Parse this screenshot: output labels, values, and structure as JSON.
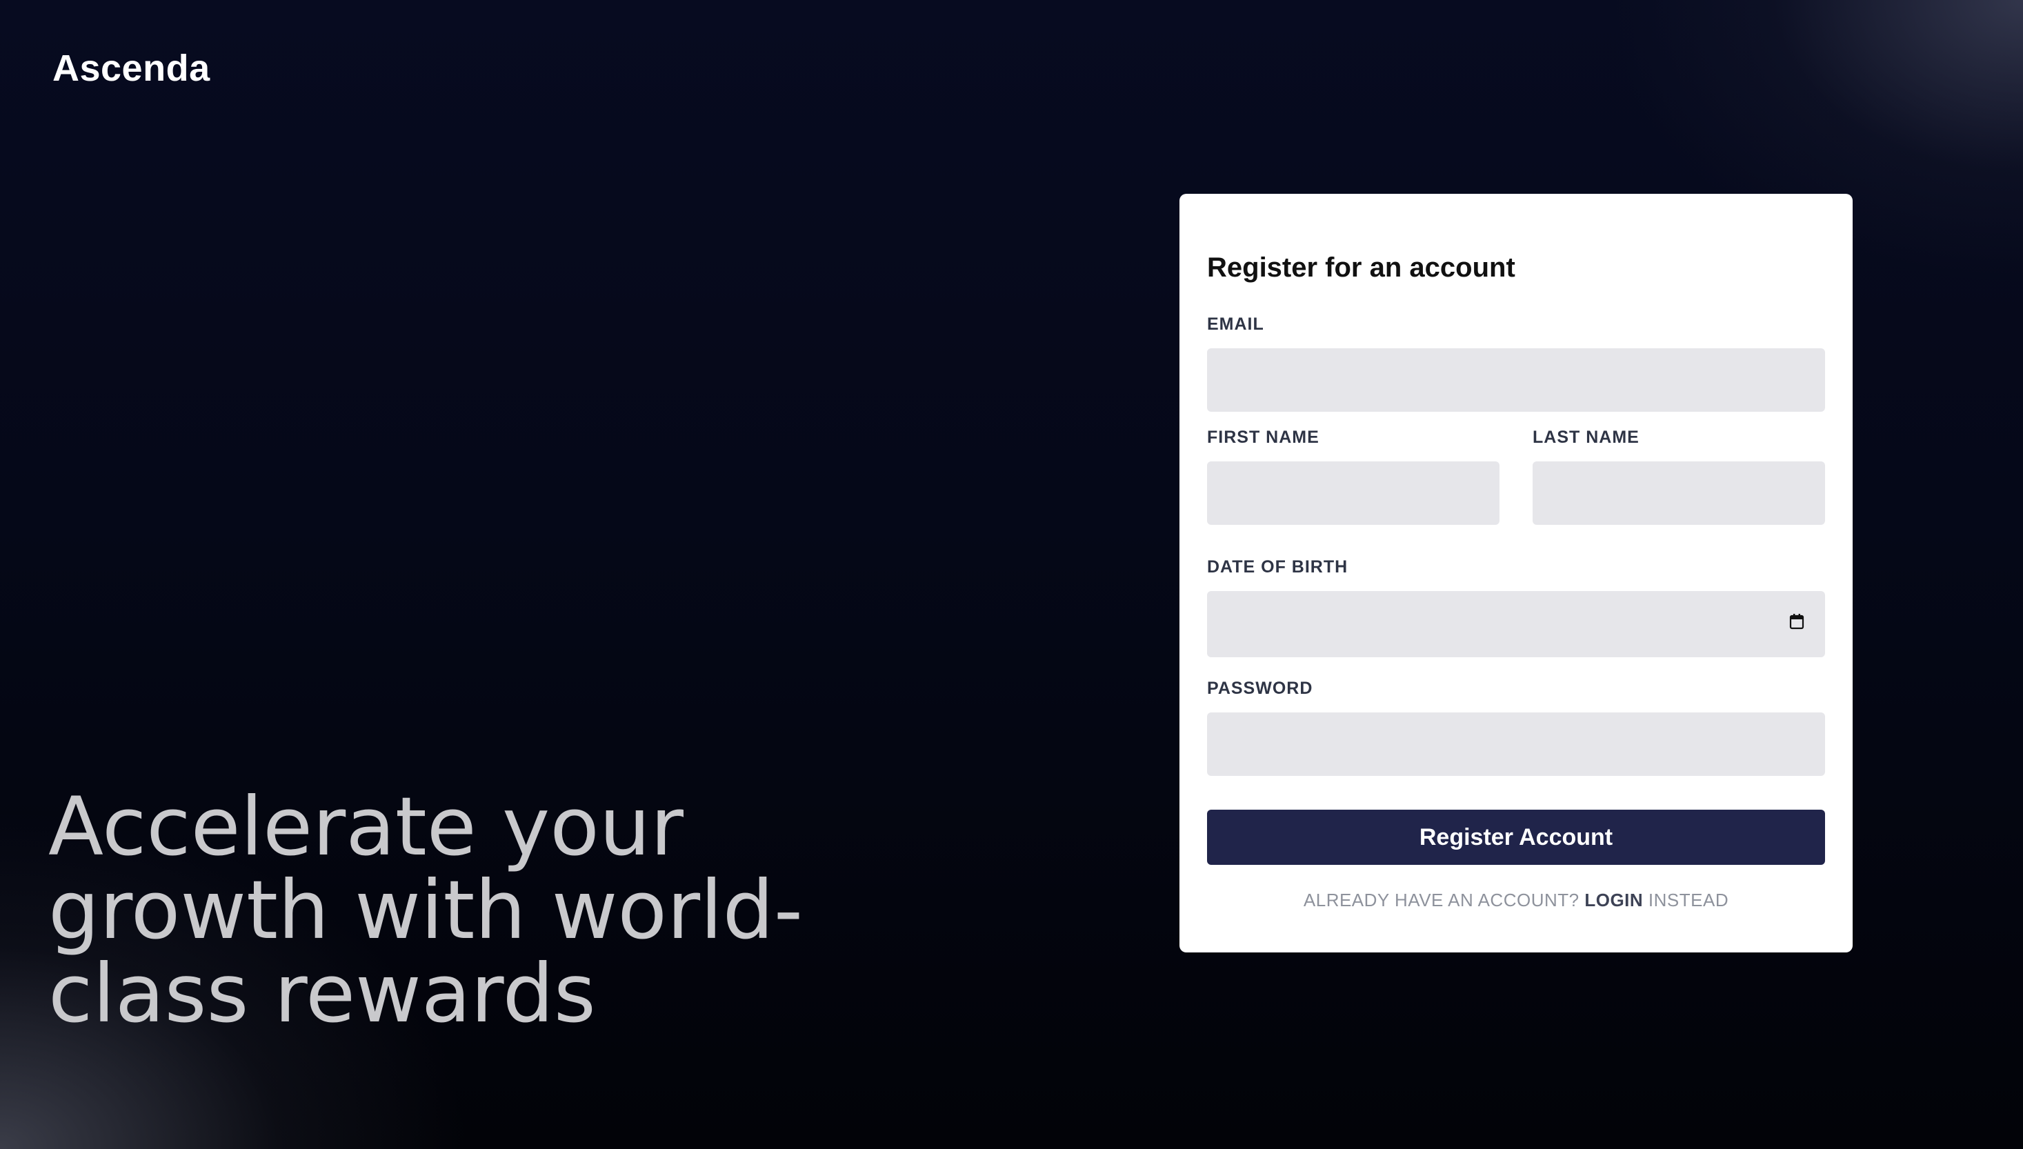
{
  "brand": {
    "logo_text": "Ascenda"
  },
  "hero": {
    "headline": "Accelerate your growth with world-class rewards"
  },
  "form": {
    "title": "Register for an account",
    "email_label": "EMAIL",
    "email_value": "",
    "first_name_label": "FIRST NAME",
    "first_name_value": "",
    "last_name_label": "LAST NAME",
    "last_name_value": "",
    "dob_label": "DATE OF BIRTH",
    "dob_value": "",
    "dob_icon": "calendar-icon",
    "password_label": "PASSWORD",
    "password_value": "",
    "submit_label": "Register Account",
    "footer_prefix": "ALREADY HAVE AN ACCOUNT?",
    "footer_link": "LOGIN",
    "footer_suffix": "INSTEAD"
  },
  "colors": {
    "background": "#050818",
    "card": "#ffffff",
    "input": "#e6e6ea",
    "button": "#20244a",
    "headline": "#c9c9cc"
  }
}
